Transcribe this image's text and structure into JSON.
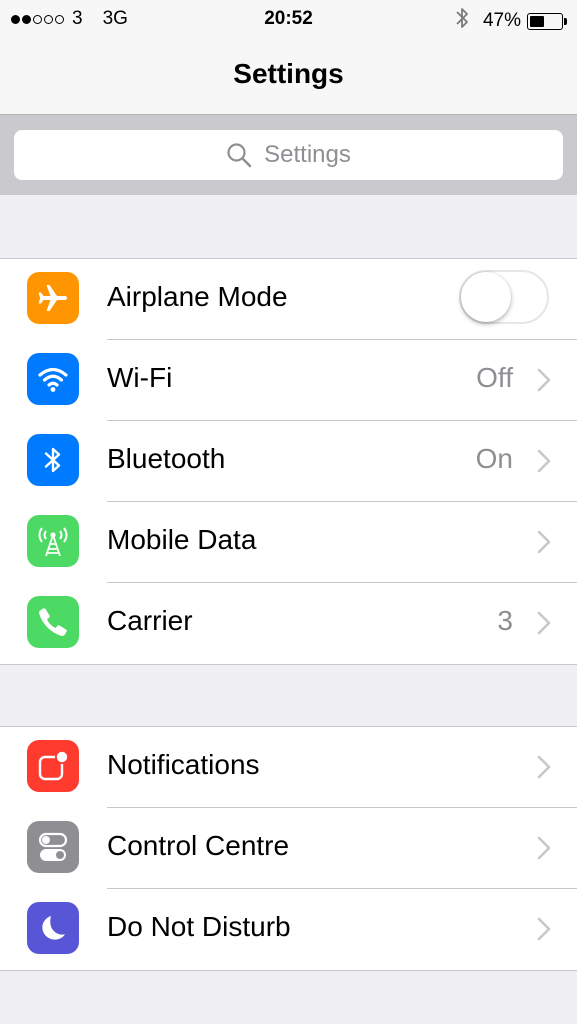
{
  "status_bar": {
    "signal_dots_filled": 2,
    "signal_dots_total": 5,
    "carrier": "3",
    "network": "3G",
    "time": "20:52",
    "battery_percent": "47%",
    "battery_level": 0.47,
    "bluetooth_icon": "bluetooth-icon"
  },
  "nav": {
    "title": "Settings"
  },
  "search": {
    "placeholder": "Settings",
    "icon": "search-icon"
  },
  "group1": [
    {
      "label": "Airplane Mode",
      "icon": "airplane-icon",
      "color": "#ff9500",
      "toggle": false
    },
    {
      "label": "Wi-Fi",
      "icon": "wifi-icon",
      "color": "#007aff",
      "value": "Off"
    },
    {
      "label": "Bluetooth",
      "icon": "bluetooth-icon",
      "color": "#007aff",
      "value": "On"
    },
    {
      "label": "Mobile Data",
      "icon": "antenna-icon",
      "color": "#4cd964",
      "value": ""
    },
    {
      "label": "Carrier",
      "icon": "phone-icon",
      "color": "#4cd964",
      "value": "3"
    }
  ],
  "group2": [
    {
      "label": "Notifications",
      "icon": "notifications-icon",
      "color": "#ff3b30"
    },
    {
      "label": "Control Centre",
      "icon": "control-centre-icon",
      "color": "#8e8e93"
    },
    {
      "label": "Do Not Disturb",
      "icon": "moon-icon",
      "color": "#5856d6"
    }
  ],
  "colors": {
    "background": "#efeff4",
    "chevron": "#c7c7cc",
    "secondary_text": "#8e8e93"
  }
}
